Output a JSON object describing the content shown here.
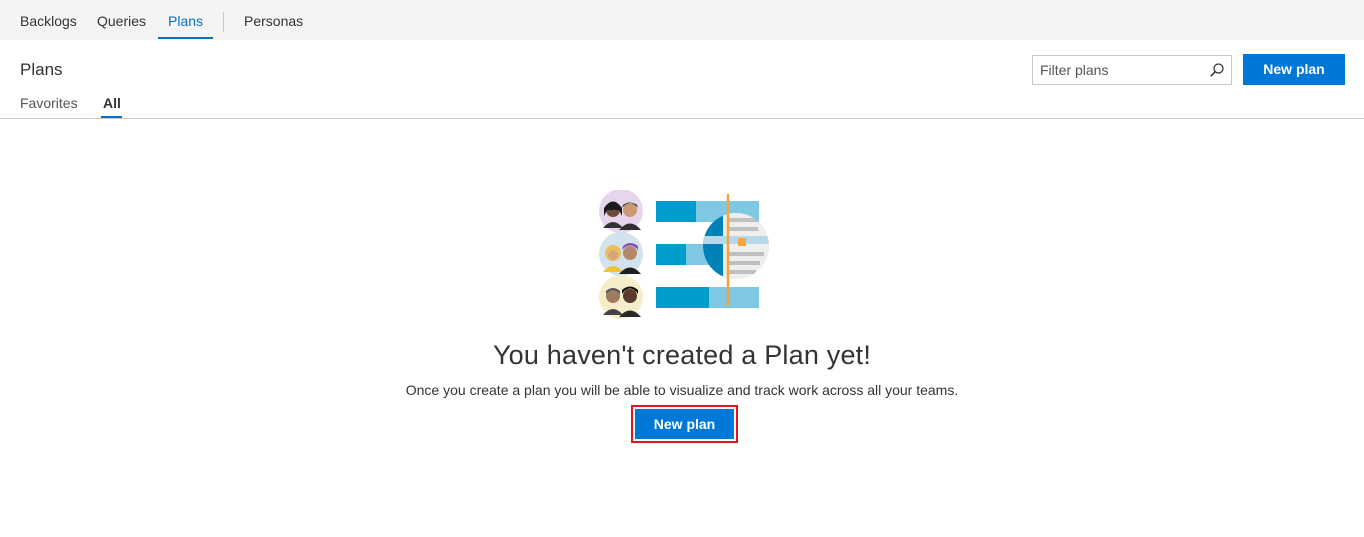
{
  "topnav": {
    "items": [
      {
        "label": "Backlogs",
        "active": false
      },
      {
        "label": "Queries",
        "active": false
      },
      {
        "label": "Plans",
        "active": true
      },
      {
        "label": "Personas",
        "active": false
      }
    ]
  },
  "page": {
    "title": "Plans",
    "subtabs": [
      {
        "label": "Favorites",
        "active": false
      },
      {
        "label": "All",
        "active": true
      }
    ]
  },
  "toolbar": {
    "filter_placeholder": "Filter plans",
    "filter_icon": "search-icon",
    "new_plan_label": "New plan"
  },
  "empty_state": {
    "illustration": "plans-teams-illustration",
    "title": "You haven't created a Plan yet!",
    "description": "Once you create a plan you will be able to visualize and track work across all your teams.",
    "button_label": "New plan"
  },
  "colors": {
    "accent": "#0078d7",
    "nav_active": "#106ebe",
    "highlight_border": "#e81123",
    "bar_dark": "#009ccc",
    "bar_light": "#7ec8e3",
    "marker": "#f2a53c"
  }
}
